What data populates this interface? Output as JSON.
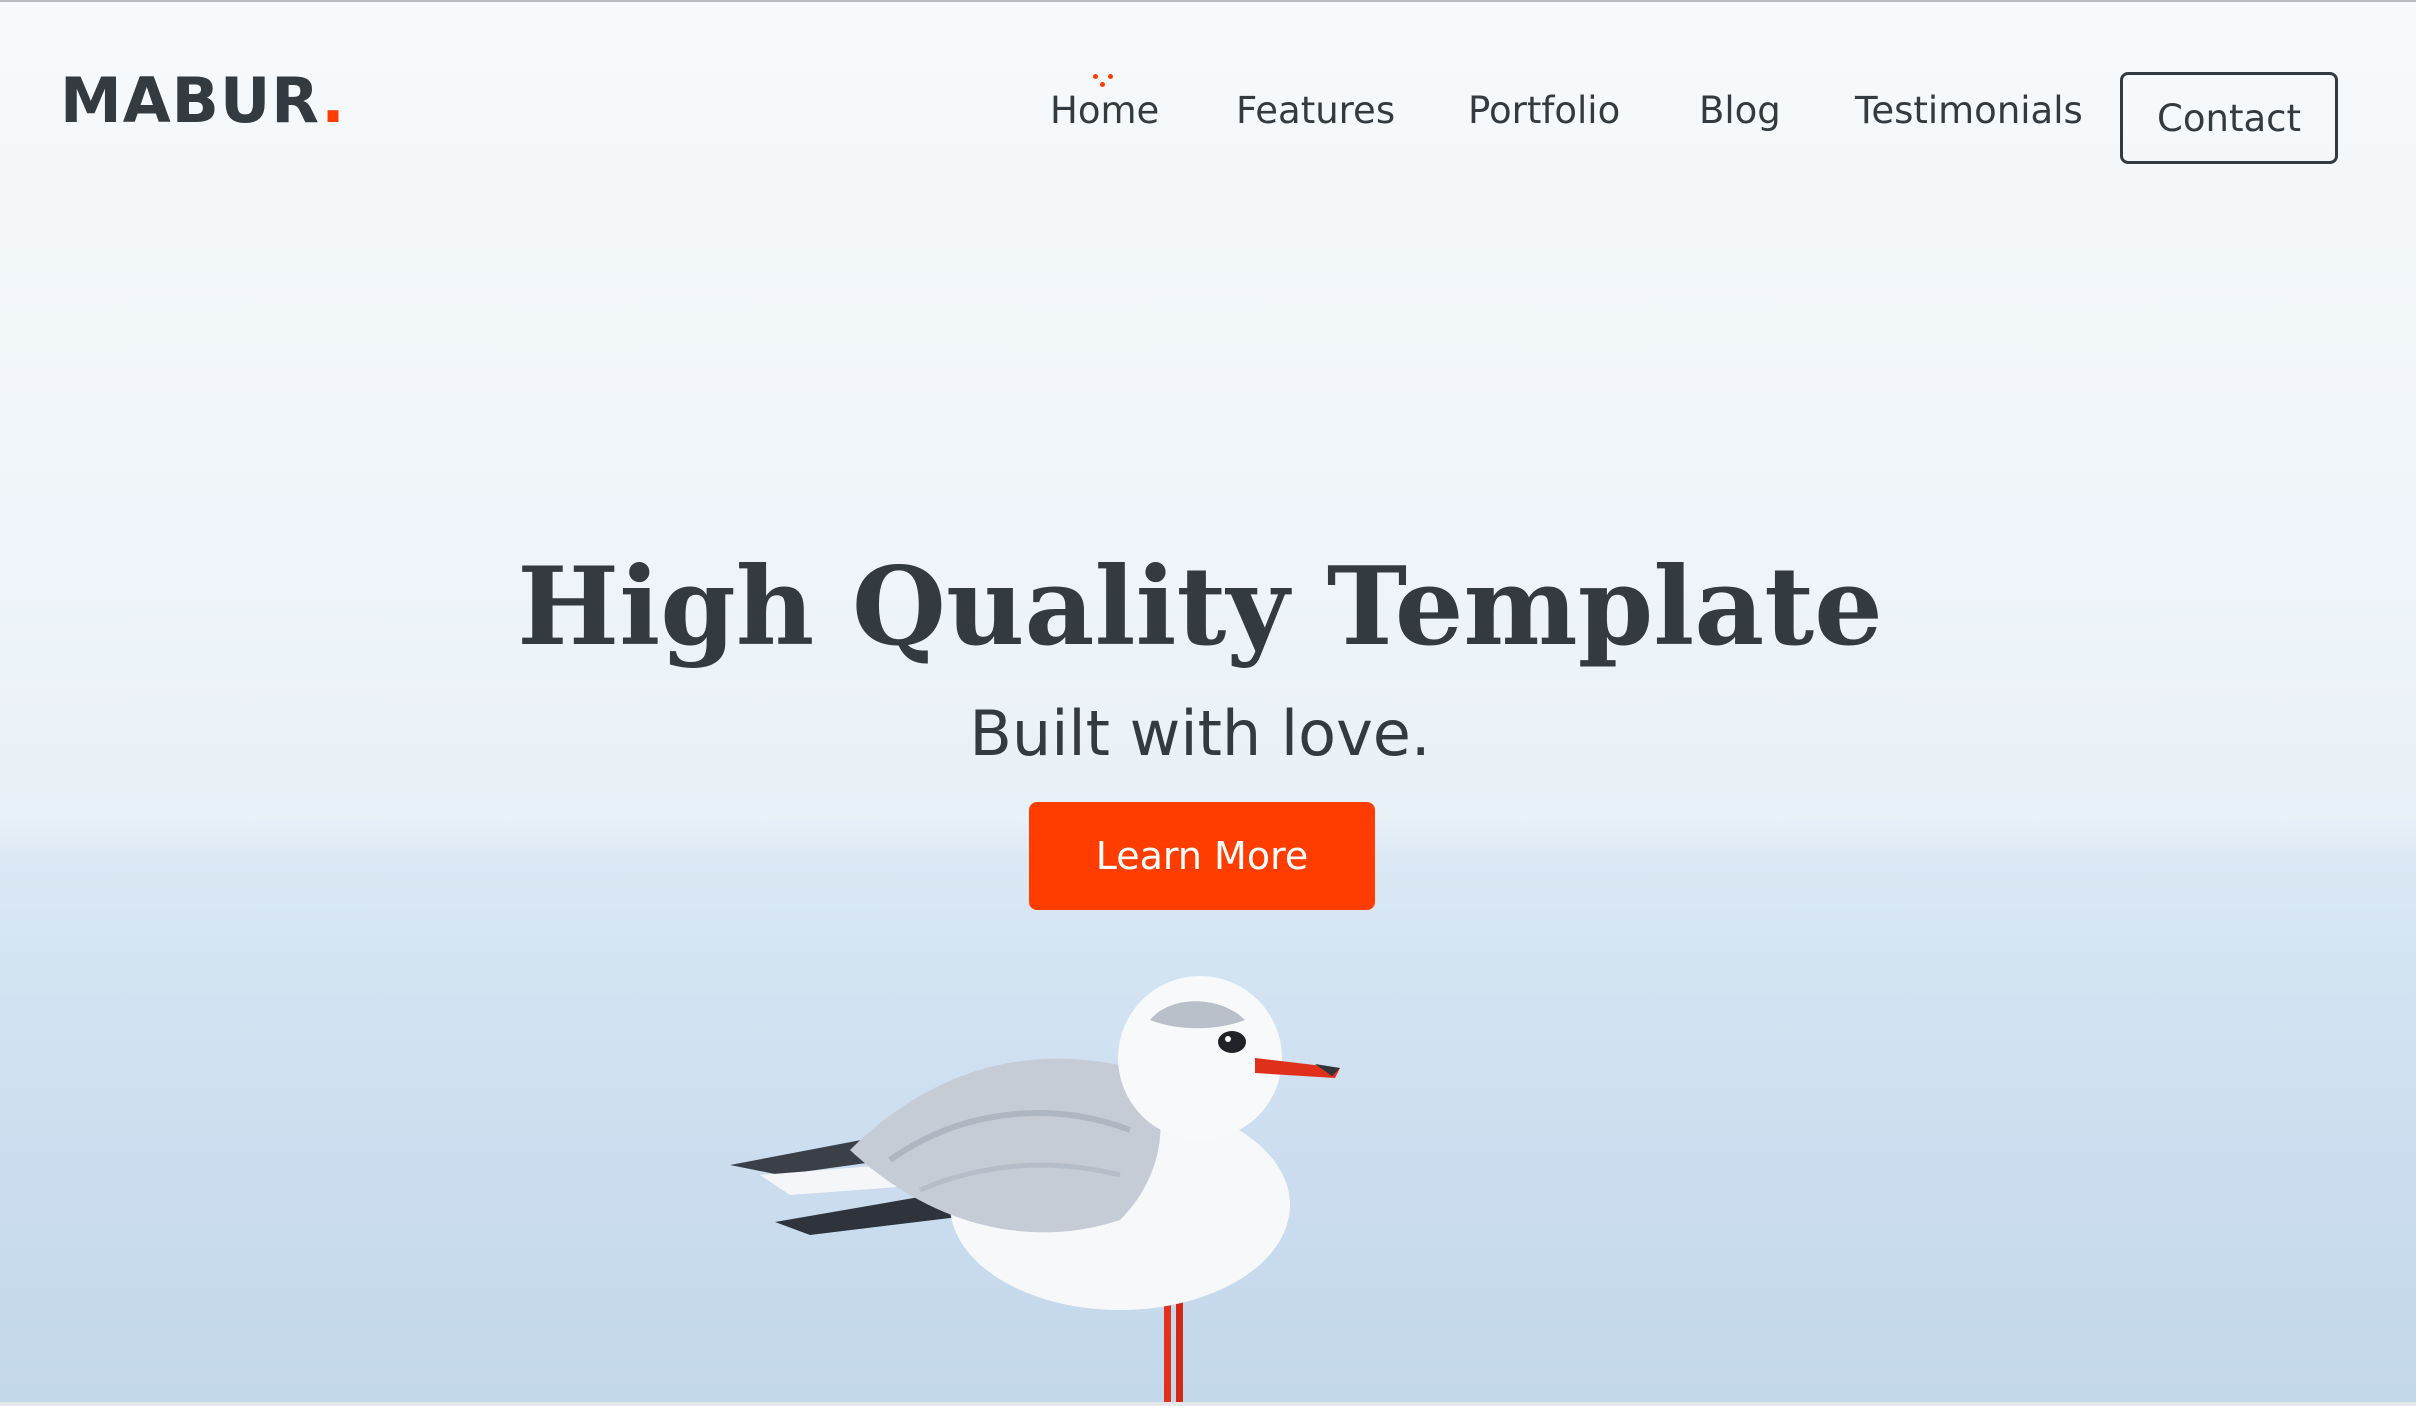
{
  "logo": {
    "text": "MABUR",
    "dot": "."
  },
  "nav": {
    "items": [
      {
        "label": "Home",
        "active": true
      },
      {
        "label": "Features"
      },
      {
        "label": "Portfolio"
      },
      {
        "label": "Blog"
      },
      {
        "label": "Testimonials"
      }
    ],
    "contact_label": "Contact"
  },
  "hero": {
    "title": "High Quality Template",
    "subtitle": "Built with love.",
    "cta_label": "Learn More",
    "image_icon": "seagull-illustration"
  },
  "colors": {
    "accent": "#ff3d00",
    "text": "#343b40",
    "sky": "#f4f8fb",
    "sea": "#cadcee"
  }
}
